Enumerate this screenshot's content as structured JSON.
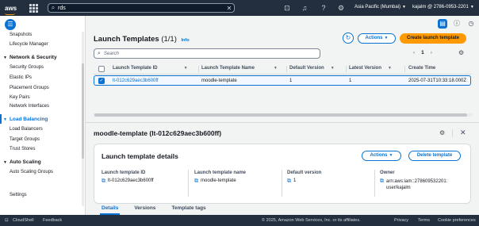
{
  "topbar": {
    "logo": "aws",
    "search_value": "rds",
    "region": "Asia Pacific (Mumbai)",
    "account": "kajalm @ 2786-0953-2201"
  },
  "sidebar": {
    "items": [
      {
        "label": "Snapshots",
        "type": "item"
      },
      {
        "label": "Lifecycle Manager",
        "type": "item"
      },
      {
        "label": "Network & Security",
        "type": "section"
      },
      {
        "label": "Security Groups",
        "type": "item"
      },
      {
        "label": "Elastic IPs",
        "type": "item"
      },
      {
        "label": "Placement Groups",
        "type": "item"
      },
      {
        "label": "Key Pairs",
        "type": "item"
      },
      {
        "label": "Network Interfaces",
        "type": "item"
      },
      {
        "label": "Load Balancing",
        "type": "section"
      },
      {
        "label": "Load Balancers",
        "type": "item"
      },
      {
        "label": "Target Groups",
        "type": "item"
      },
      {
        "label": "Trust Stores",
        "type": "item"
      },
      {
        "label": "Auto Scaling",
        "type": "section"
      },
      {
        "label": "Auto Scaling Groups",
        "type": "item"
      },
      {
        "label": "Settings",
        "type": "item"
      }
    ]
  },
  "list": {
    "title": "Launch Templates",
    "count": "(1/1)",
    "info": "Info",
    "actions_label": "Actions",
    "create_label": "Create launch template",
    "search_placeholder": "Search",
    "page": "1",
    "prev": "‹",
    "next": "›",
    "columns": [
      "Launch Template ID",
      "Launch Template Name",
      "Default Version",
      "Latest Version",
      "Create Time"
    ],
    "rows": [
      {
        "id": "lt-012c629aec3b600ff",
        "name": "moodle-template",
        "default_version": "1",
        "latest_version": "1",
        "create_time": "2025-07-31T10:33:18.000Z"
      }
    ]
  },
  "detail": {
    "title": "moodle-template (lt-012c629aec3b600ff)",
    "card_title": "Launch template details",
    "actions_label": "Actions",
    "delete_label": "Delete template",
    "fields": {
      "id_label": "Launch template ID",
      "id_value": "lt-012c629aec3b600ff",
      "name_label": "Launch template name",
      "name_value": "moodle-template",
      "default_label": "Default version",
      "default_value": "1",
      "owner_label": "Owner",
      "owner_value": "arn:aws:iam::278609532201:user/kajalm"
    },
    "tabs": [
      "Details",
      "Versions",
      "Template tags"
    ]
  },
  "footer": {
    "cloudshell": "CloudShell",
    "feedback": "Feedback",
    "copyright": "© 2025, Amazon Web Services, Inc. or its affiliates.",
    "privacy": "Privacy",
    "terms": "Terms",
    "cookies": "Cookie preferences"
  },
  "icons": {
    "search": "magnifier",
    "clear": "x",
    "brand_color": "#ff9900",
    "link_color": "#0972d3"
  }
}
